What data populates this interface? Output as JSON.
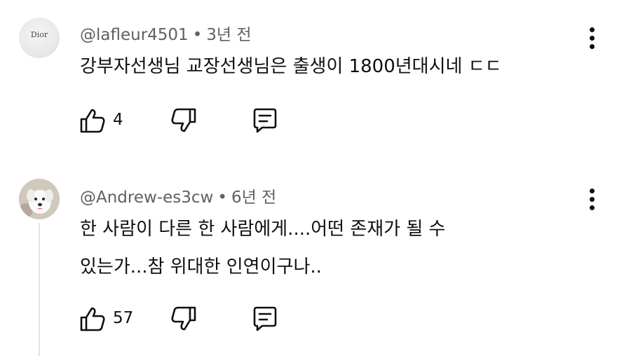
{
  "comments": [
    {
      "avatar_text": "Dior",
      "username": "@lafleur4501",
      "time": "3년 전",
      "body_lines": [
        "강부자선생님 교장선생님은 출생이 1800년대시네 ㄷㄷ"
      ],
      "likes": "4"
    },
    {
      "avatar_text": "",
      "username": "@Andrew-es3cw",
      "time": "6년 전",
      "body_lines": [
        "한 사람이 다른 한 사람에게....어떤 존재가 될 수",
        "있는가...참 위대한 인연이구나.."
      ],
      "likes": "57"
    }
  ],
  "separator": "•"
}
